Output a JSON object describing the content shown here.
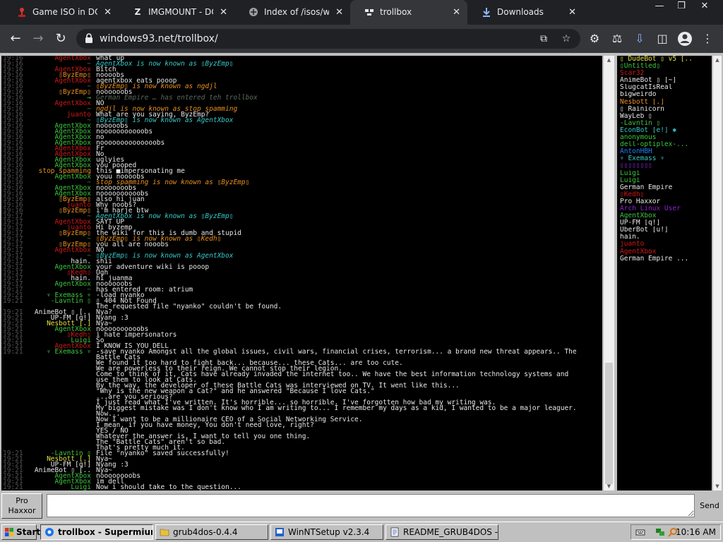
{
  "browser": {
    "tabs": [
      {
        "title": "Game ISO in DOSBox",
        "favicon": "joystick-icon",
        "active": false
      },
      {
        "title": "IMGMOUNT - DOSBox",
        "favicon": "z-logo-icon",
        "active": false
      },
      {
        "title": "Index of /isos/windows",
        "favicon": "archive-icon",
        "active": false
      },
      {
        "title": "trollbox",
        "favicon": "trollbox-icon",
        "active": true
      },
      {
        "title": "Downloads",
        "favicon": "download-icon",
        "active": false
      }
    ],
    "url": "windows93.net/trollbox/"
  },
  "colors": {
    "green": "#3ec63e",
    "cyan": "#39c8c8",
    "red": "#d01818",
    "orange": "#e89020",
    "yellow": "#e8e040",
    "grey": "#5a6a5a",
    "purple": "#9020d0",
    "blue": "#2080ff",
    "white": "#e8e8e8",
    "pink": "#ff3070"
  },
  "chat": {
    "lines": [
      {
        "ts": "19:16",
        "nick": "AgentXbox",
        "color": "red",
        "text": "what up",
        "sys": false
      },
      {
        "ts": "19:16",
        "nick": "~",
        "color": "grey",
        "text": "AgentXbox is now known as ▯ByzEmp▯",
        "sys": true,
        "textcolor": "cyan"
      },
      {
        "ts": "19:16",
        "nick": "AgentXbox",
        "color": "red",
        "text": "Bitch",
        "sys": false
      },
      {
        "ts": "19:16",
        "nick": "▯ByzEmp▯",
        "color": "orange",
        "text": "noooobs",
        "sys": false
      },
      {
        "ts": "19:16",
        "nick": "AgentXbox",
        "color": "red",
        "text": "agentxbox eats pooop",
        "sys": false
      },
      {
        "ts": "19:16",
        "nick": "~",
        "color": "grey",
        "text": "▯ByzEmp▯ is now known as ngdjl",
        "sys": true,
        "textcolor": "orange"
      },
      {
        "ts": "19:16",
        "nick": "▯ByzEmp▯",
        "color": "orange",
        "text": "noooooobs",
        "sys": false
      },
      {
        "ts": "19:16",
        "nick": "→",
        "color": "green",
        "text": "German Empire … has entered teh trollbox",
        "sys": true,
        "textcolor": "grey"
      },
      {
        "ts": "19:16",
        "nick": "AgentXbox",
        "color": "red",
        "text": "NO",
        "sys": false
      },
      {
        "ts": "19:16",
        "nick": "~",
        "color": "grey",
        "text": "ngdjl is now known as stop spamming",
        "sys": true,
        "textcolor": "orange"
      },
      {
        "ts": "19:16",
        "nick": "juanto",
        "color": "red",
        "text": "What are you saying, ByzEmp?",
        "sys": false
      },
      {
        "ts": "19:16",
        "nick": "~",
        "color": "grey",
        "text": "▯ByzEmp▯ is now known as AgentXbox",
        "sys": true,
        "textcolor": "cyan"
      },
      {
        "ts": "19:16",
        "nick": "AgentXbox",
        "color": "green",
        "text": "nooooobs",
        "sys": false
      },
      {
        "ts": "19:16",
        "nick": "AgentXbox",
        "color": "green",
        "text": "nooooooooooobs",
        "sys": false
      },
      {
        "ts": "19:16",
        "nick": "AgentXbox",
        "color": "green",
        "text": "no",
        "sys": false
      },
      {
        "ts": "19:16",
        "nick": "AgentXbox",
        "color": "green",
        "text": "noooooooooooooobs",
        "sys": false
      },
      {
        "ts": "19:16",
        "nick": "AgentXbox",
        "color": "red",
        "text": "Fr",
        "sys": false
      },
      {
        "ts": "19:16",
        "nick": "AgentXbox",
        "color": "red",
        "text": "No",
        "sys": false
      },
      {
        "ts": "19:16",
        "nick": "AgentXbox",
        "color": "green",
        "text": "uglyies",
        "sys": false
      },
      {
        "ts": "19:16",
        "nick": "AgentXbox",
        "color": "green",
        "text": "you pooped",
        "sys": false
      },
      {
        "ts": "19:16",
        "nick": "stop spamming",
        "color": "orange",
        "text": "this ■impersonating me",
        "sys": false
      },
      {
        "ts": "19:16",
        "nick": "AgentXbox",
        "color": "green",
        "text": "youu noooobs",
        "sys": false
      },
      {
        "ts": "19:16",
        "nick": "~",
        "color": "grey",
        "text": "stop spamming is now known as ▯ByzEmp▯",
        "sys": true,
        "textcolor": "orange"
      },
      {
        "ts": "19:16",
        "nick": "AgentXbox",
        "color": "green",
        "text": "nooooooobs",
        "sys": false
      },
      {
        "ts": "19:16",
        "nick": "AgentXbox",
        "color": "green",
        "text": "noooooooooobs",
        "sys": false
      },
      {
        "ts": "19:16",
        "nick": "▯ByzEmp▯",
        "color": "orange",
        "text": "also hi juan",
        "sys": false
      },
      {
        "ts": "19:16",
        "nick": "juanto",
        "color": "red",
        "text": "Why noobs?",
        "sys": false
      },
      {
        "ts": "19:16",
        "nick": "▯ByzEmp▯",
        "color": "orange",
        "text": "i'm harje btw",
        "sys": false
      },
      {
        "ts": "19:17",
        "nick": "~",
        "color": "grey",
        "text": "AgentXbox is now known as ▯ByzEmp▯",
        "sys": true,
        "textcolor": "cyan"
      },
      {
        "ts": "19:17",
        "nick": "AgentXbox",
        "color": "red",
        "text": "SAYT UP",
        "sys": false
      },
      {
        "ts": "19:17",
        "nick": "juanto",
        "color": "red",
        "text": "Hi byzemp",
        "sys": false
      },
      {
        "ts": "19:17",
        "nick": "▯ByzEmp▯",
        "color": "orange",
        "text": "the wiki for this is dumb and stupid",
        "sys": false
      },
      {
        "ts": "19:17",
        "nick": "~",
        "color": "grey",
        "text": "▯ByzEmp▯ is now known as ▯Kedh▯",
        "sys": true,
        "textcolor": "orange"
      },
      {
        "ts": "19:17",
        "nick": "▯ByzEmp▯",
        "color": "orange",
        "text": "you all are nooobs",
        "sys": false
      },
      {
        "ts": "19:17",
        "nick": "AgentXbox",
        "color": "red",
        "text": "NO",
        "sys": false
      },
      {
        "ts": "19:17",
        "nick": "~",
        "color": "grey",
        "text": "▯ByzEmp▯ is now known as AgentXbox",
        "sys": true,
        "textcolor": "cyan"
      },
      {
        "ts": "19:17",
        "nick": "hain.",
        "color": "white",
        "text": "shii",
        "sys": false
      },
      {
        "ts": "19:17",
        "nick": "AgentXbox",
        "color": "green",
        "text": "your adventure wiki is pooop",
        "sys": false
      },
      {
        "ts": "19:17",
        "nick": "▯Kedh▯",
        "color": "red",
        "text": "Ugh",
        "sys": false
      },
      {
        "ts": "19:17",
        "nick": "hain.",
        "color": "white",
        "text": "hi juanma",
        "sys": false
      },
      {
        "ts": "19:17",
        "nick": "AgentXbox",
        "color": "green",
        "text": "noooooobs",
        "sys": false
      },
      {
        "ts": "19:17",
        "nick": "~",
        "color": "grey",
        "text": "has entered room: atrium",
        "sys": false,
        "textcolor": "white"
      },
      {
        "ts": "19:21",
        "nick": "▿ Exemass ▿",
        "color": "green",
        "text": "-load nyanko",
        "sys": false
      },
      {
        "ts": "19:21",
        "nick": "-Lavntin ▯",
        "color": "green",
        "text": "▯ 404 Not Found",
        "sys": false
      },
      {
        "ts": "",
        "nick": "",
        "color": "green",
        "text": "The requested file \"nyanko\" couldn't be found.",
        "sys": false
      },
      {
        "ts": "19:21",
        "nick": "AnimeBot ▯ [..",
        "color": "white",
        "text": "Nya?",
        "sys": false
      },
      {
        "ts": "19:21",
        "nick": "UP-FM [q!]",
        "color": "white",
        "text": "Nyang :3",
        "sys": false
      },
      {
        "ts": "19:21",
        "nick": "Nesbott [.]",
        "color": "yellow",
        "text": "Nya~",
        "sys": false
      },
      {
        "ts": "19:21",
        "nick": "AgentXbox",
        "color": "green",
        "text": "noooooooooobs",
        "sys": false
      },
      {
        "ts": "19:21",
        "nick": "▯Kedh▯",
        "color": "red",
        "text": "i hate impersonators",
        "sys": false
      },
      {
        "ts": "19:21",
        "nick": "Luigi",
        "color": "green",
        "text": "So",
        "sys": false
      },
      {
        "ts": "19:21",
        "nick": "AgentXbox",
        "color": "red",
        "text": "I KNOW IS YOU DELL",
        "sys": false
      },
      {
        "ts": "19:21",
        "nick": "▿ Exemass ▿",
        "color": "green",
        "text": "-save nyanko Amongst all the global issues, civil wars, financial crises, terrorism... a brand new threat appears.. The",
        "sys": false
      },
      {
        "ts": "",
        "nick": "",
        "color": "green",
        "text": "Battle Cats",
        "sys": false
      },
      {
        "ts": "",
        "nick": "",
        "color": "green",
        "text": "We found it too hard to fight back... because... these Cats... are too cute.",
        "sys": false
      },
      {
        "ts": "",
        "nick": "",
        "color": "green",
        "text": "We are powerless to their reign. We cannot stop their legion.",
        "sys": false
      },
      {
        "ts": "",
        "nick": "",
        "color": "green",
        "text": "Come to think of it, Cats have already invaded the internet too.. We have the best information technology systems and",
        "sys": false
      },
      {
        "ts": "",
        "nick": "",
        "color": "green",
        "text": "use them to look at Cats.",
        "sys": false
      },
      {
        "ts": "",
        "nick": "",
        "color": "green",
        "text": "By the way, the developer of these Battle Cats was interviewed on TV. It went like this...",
        "sys": false
      },
      {
        "ts": "",
        "nick": "",
        "color": "green",
        "text": "\"Why is the new weapon a Cat?\" and he answered \"Because I love Cats.\"",
        "sys": false
      },
      {
        "ts": "",
        "nick": "",
        "color": "green",
        "text": "...are you serious?",
        "sys": false
      },
      {
        "ts": "",
        "nick": "",
        "color": "green",
        "text": "I just read what I've written. It's horrible... so horrible. I've forgotten how bad my writing was.",
        "sys": false
      },
      {
        "ts": "",
        "nick": "",
        "color": "green",
        "text": "My biggest mistake was I don't know who I am writing to... I remember my days as a kid, I wanted to be a major leaguer.",
        "sys": false
      },
      {
        "ts": "",
        "nick": "",
        "color": "green",
        "text": "Now...",
        "sys": false
      },
      {
        "ts": "",
        "nick": "",
        "color": "green",
        "text": "Now I want to be a millionaire CEO of a Social Networking Service.",
        "sys": false
      },
      {
        "ts": "",
        "nick": "",
        "color": "green",
        "text": "I mean, if you have money, You don't need love, right?",
        "sys": false
      },
      {
        "ts": "",
        "nick": "",
        "color": "green",
        "text": "YES / NO",
        "sys": false
      },
      {
        "ts": "",
        "nick": "",
        "color": "green",
        "text": "Whatever the answer is, I want to tell you one thing.",
        "sys": false
      },
      {
        "ts": "",
        "nick": "",
        "color": "green",
        "text": "The \"Battle Cats\" aren't so bad.",
        "sys": false
      },
      {
        "ts": "",
        "nick": "",
        "color": "green",
        "text": "That's pretty much it.",
        "sys": false
      },
      {
        "ts": "19:21",
        "nick": "-Lavntin ▯",
        "color": "green",
        "text": "File \"nyanko\" saved successfully!",
        "sys": false
      },
      {
        "ts": "19:21",
        "nick": "Nesbott [.]",
        "color": "yellow",
        "text": "Nya~",
        "sys": false
      },
      {
        "ts": "19:21",
        "nick": "UP-FM [q!]",
        "color": "white",
        "text": "Nyang :3",
        "sys": false
      },
      {
        "ts": "19:21",
        "nick": "AnimeBot ▯ [..",
        "color": "white",
        "text": "Nya~",
        "sys": false
      },
      {
        "ts": "19:21",
        "nick": "AgentXbox",
        "color": "green",
        "text": "noooooooobs",
        "sys": false
      },
      {
        "ts": "19:21",
        "nick": "AgentXbox",
        "color": "green",
        "text": "im dell",
        "sys": false
      },
      {
        "ts": "19:21",
        "nick": "Luigi",
        "color": "green",
        "text": "Now i should take to the question...",
        "sys": false
      }
    ],
    "input_value": "",
    "send_label": "Send",
    "pseudo_label": "Pro\nHaxxor"
  },
  "users": [
    {
      "name": "▯ DudeBot ▯ v5 [..",
      "color": "yellow"
    },
    {
      "name": "▯Untitled▯",
      "color": "green"
    },
    {
      "name": "Scar32",
      "color": "red"
    },
    {
      "name": "AnimeBot ▯ [~]",
      "color": "white"
    },
    {
      "name": "SlugcatIsReal",
      "color": "white"
    },
    {
      "name": "bigweirdo",
      "color": "white"
    },
    {
      "name": "Nesbott [.]",
      "color": "orange"
    },
    {
      "name": "▯ Rainicorn",
      "color": "white"
    },
    {
      "name": "WayLeb ▯",
      "color": "white"
    },
    {
      "name": "-Lavntin ▯",
      "color": "green"
    },
    {
      "name": "EconBot [e!] ✱",
      "color": "cyan"
    },
    {
      "name": "anonymous",
      "color": "green"
    },
    {
      "name": "dell-optiplex-...",
      "color": "green"
    },
    {
      "name": "AntonHBH",
      "color": "blue"
    },
    {
      "name": "▿ Exemass ▿",
      "color": "cyan"
    },
    {
      "name": "▯▯▯▯▯▯▯▯",
      "color": "purple"
    },
    {
      "name": "Luigi",
      "color": "green"
    },
    {
      "name": "Luigi",
      "color": "green"
    },
    {
      "name": "German Empire",
      "color": "white"
    },
    {
      "name": "▯Kedh▯",
      "color": "red"
    },
    {
      "name": "Pro Haxxor",
      "color": "white"
    },
    {
      "name": "Arch Linux User",
      "color": "purple"
    },
    {
      "name": "AgentXbox",
      "color": "green"
    },
    {
      "name": "UP-FM [q!]",
      "color": "white"
    },
    {
      "name": "UberBot [u!]",
      "color": "white"
    },
    {
      "name": "hain.",
      "color": "white"
    },
    {
      "name": "juanto",
      "color": "red"
    },
    {
      "name": "AgentXbox",
      "color": "red"
    },
    {
      "name": "German Empire ...",
      "color": "white"
    }
  ],
  "taskbar": {
    "start_label": "Start",
    "items": [
      {
        "label": "trollbox - Supermium",
        "icon": "browser-icon",
        "active": true
      },
      {
        "label": "grub4dos-0.4.4",
        "icon": "folder-icon",
        "active": false
      },
      {
        "label": "WinNTSetup v2.3.4",
        "icon": "setup-icon",
        "active": false
      },
      {
        "label": "README_GRUB4DOS - ...",
        "icon": "notepad-icon",
        "active": false
      }
    ],
    "clock": "10:16 AM"
  }
}
